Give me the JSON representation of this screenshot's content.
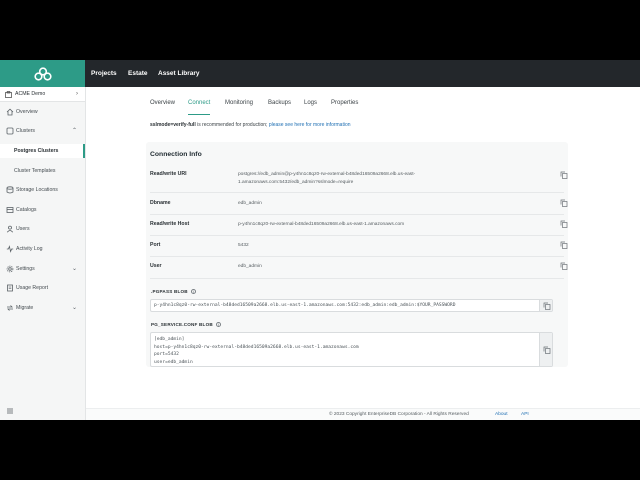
{
  "topbar": {
    "nav": [
      "Projects",
      "Estate",
      "Asset Library"
    ]
  },
  "sidebar": {
    "org_name": "ACME Demo",
    "items": [
      {
        "label": "Overview",
        "icon": "home-icon"
      },
      {
        "label": "Clusters",
        "icon": "cluster-icon",
        "expanded": true
      },
      {
        "label": "Postgres Clusters",
        "sub": true,
        "active": true
      },
      {
        "label": "Cluster Templates",
        "sub": true
      },
      {
        "label": "Storage Locations",
        "icon": "storage-icon"
      },
      {
        "label": "Catalogs",
        "icon": "catalog-icon"
      },
      {
        "label": "Users",
        "icon": "user-icon"
      },
      {
        "label": "Activity Log",
        "icon": "activity-icon"
      },
      {
        "label": "Settings",
        "icon": "gear-icon",
        "chevron": true
      },
      {
        "label": "Usage Report",
        "icon": "report-icon"
      },
      {
        "label": "Migrate",
        "icon": "migrate-icon",
        "chevron": true
      }
    ]
  },
  "tabs": [
    "Overview",
    "Connect",
    "Monitoring",
    "Backups",
    "Logs",
    "Properties"
  ],
  "active_tab": "Connect",
  "notice": {
    "bold": "sslmode=verify-full",
    "text": " is recommended for production; ",
    "link": "please see here for more information"
  },
  "connection": {
    "title": "Connection Info",
    "rows": [
      {
        "label": "Read/write URI",
        "value": "postgres://edb_admin@p-y4hn1c8qz0-rw-external-b48ded16509a2668.elb.us-east-1.amazonaws.com:5432/edb_admin?sslmode=require"
      },
      {
        "label": "Dbname",
        "value": "edb_admin"
      },
      {
        "label": "Read/write Host",
        "value": "p-y4hn1c8qz0-rw-external-b48ded16509a2668.elb.us-east-1.amazonaws.com"
      },
      {
        "label": "Port",
        "value": "5432"
      },
      {
        "label": "User",
        "value": "edb_admin"
      }
    ],
    "pgpass_title": ".PGPASS BLOB",
    "pgpass_value": "p-y4hn1c8qz0-rw-external-b48ded16509a2668.elb.us-east-1.amazonaws.com:5432:edb_admin:edb_admin:$YOUR_PASSWORD",
    "service_title": "PG_SERVICE.CONF BLOB",
    "service_lines": [
      "[edb_admin]",
      "host=p-y4hn1c8qz0-rw-external-b48ded16509a2668.elb.us-east-1.amazonaws.com",
      "port=5432",
      "user=edb_admin"
    ]
  },
  "footer": {
    "copyright": "© 2023 Copyright EnterpriseDB Corporation - All Rights Reserved",
    "about": "About",
    "api": "API"
  },
  "colors": {
    "brand": "#2d9b87",
    "topbar": "#23272b",
    "link": "#1f6fb3"
  }
}
